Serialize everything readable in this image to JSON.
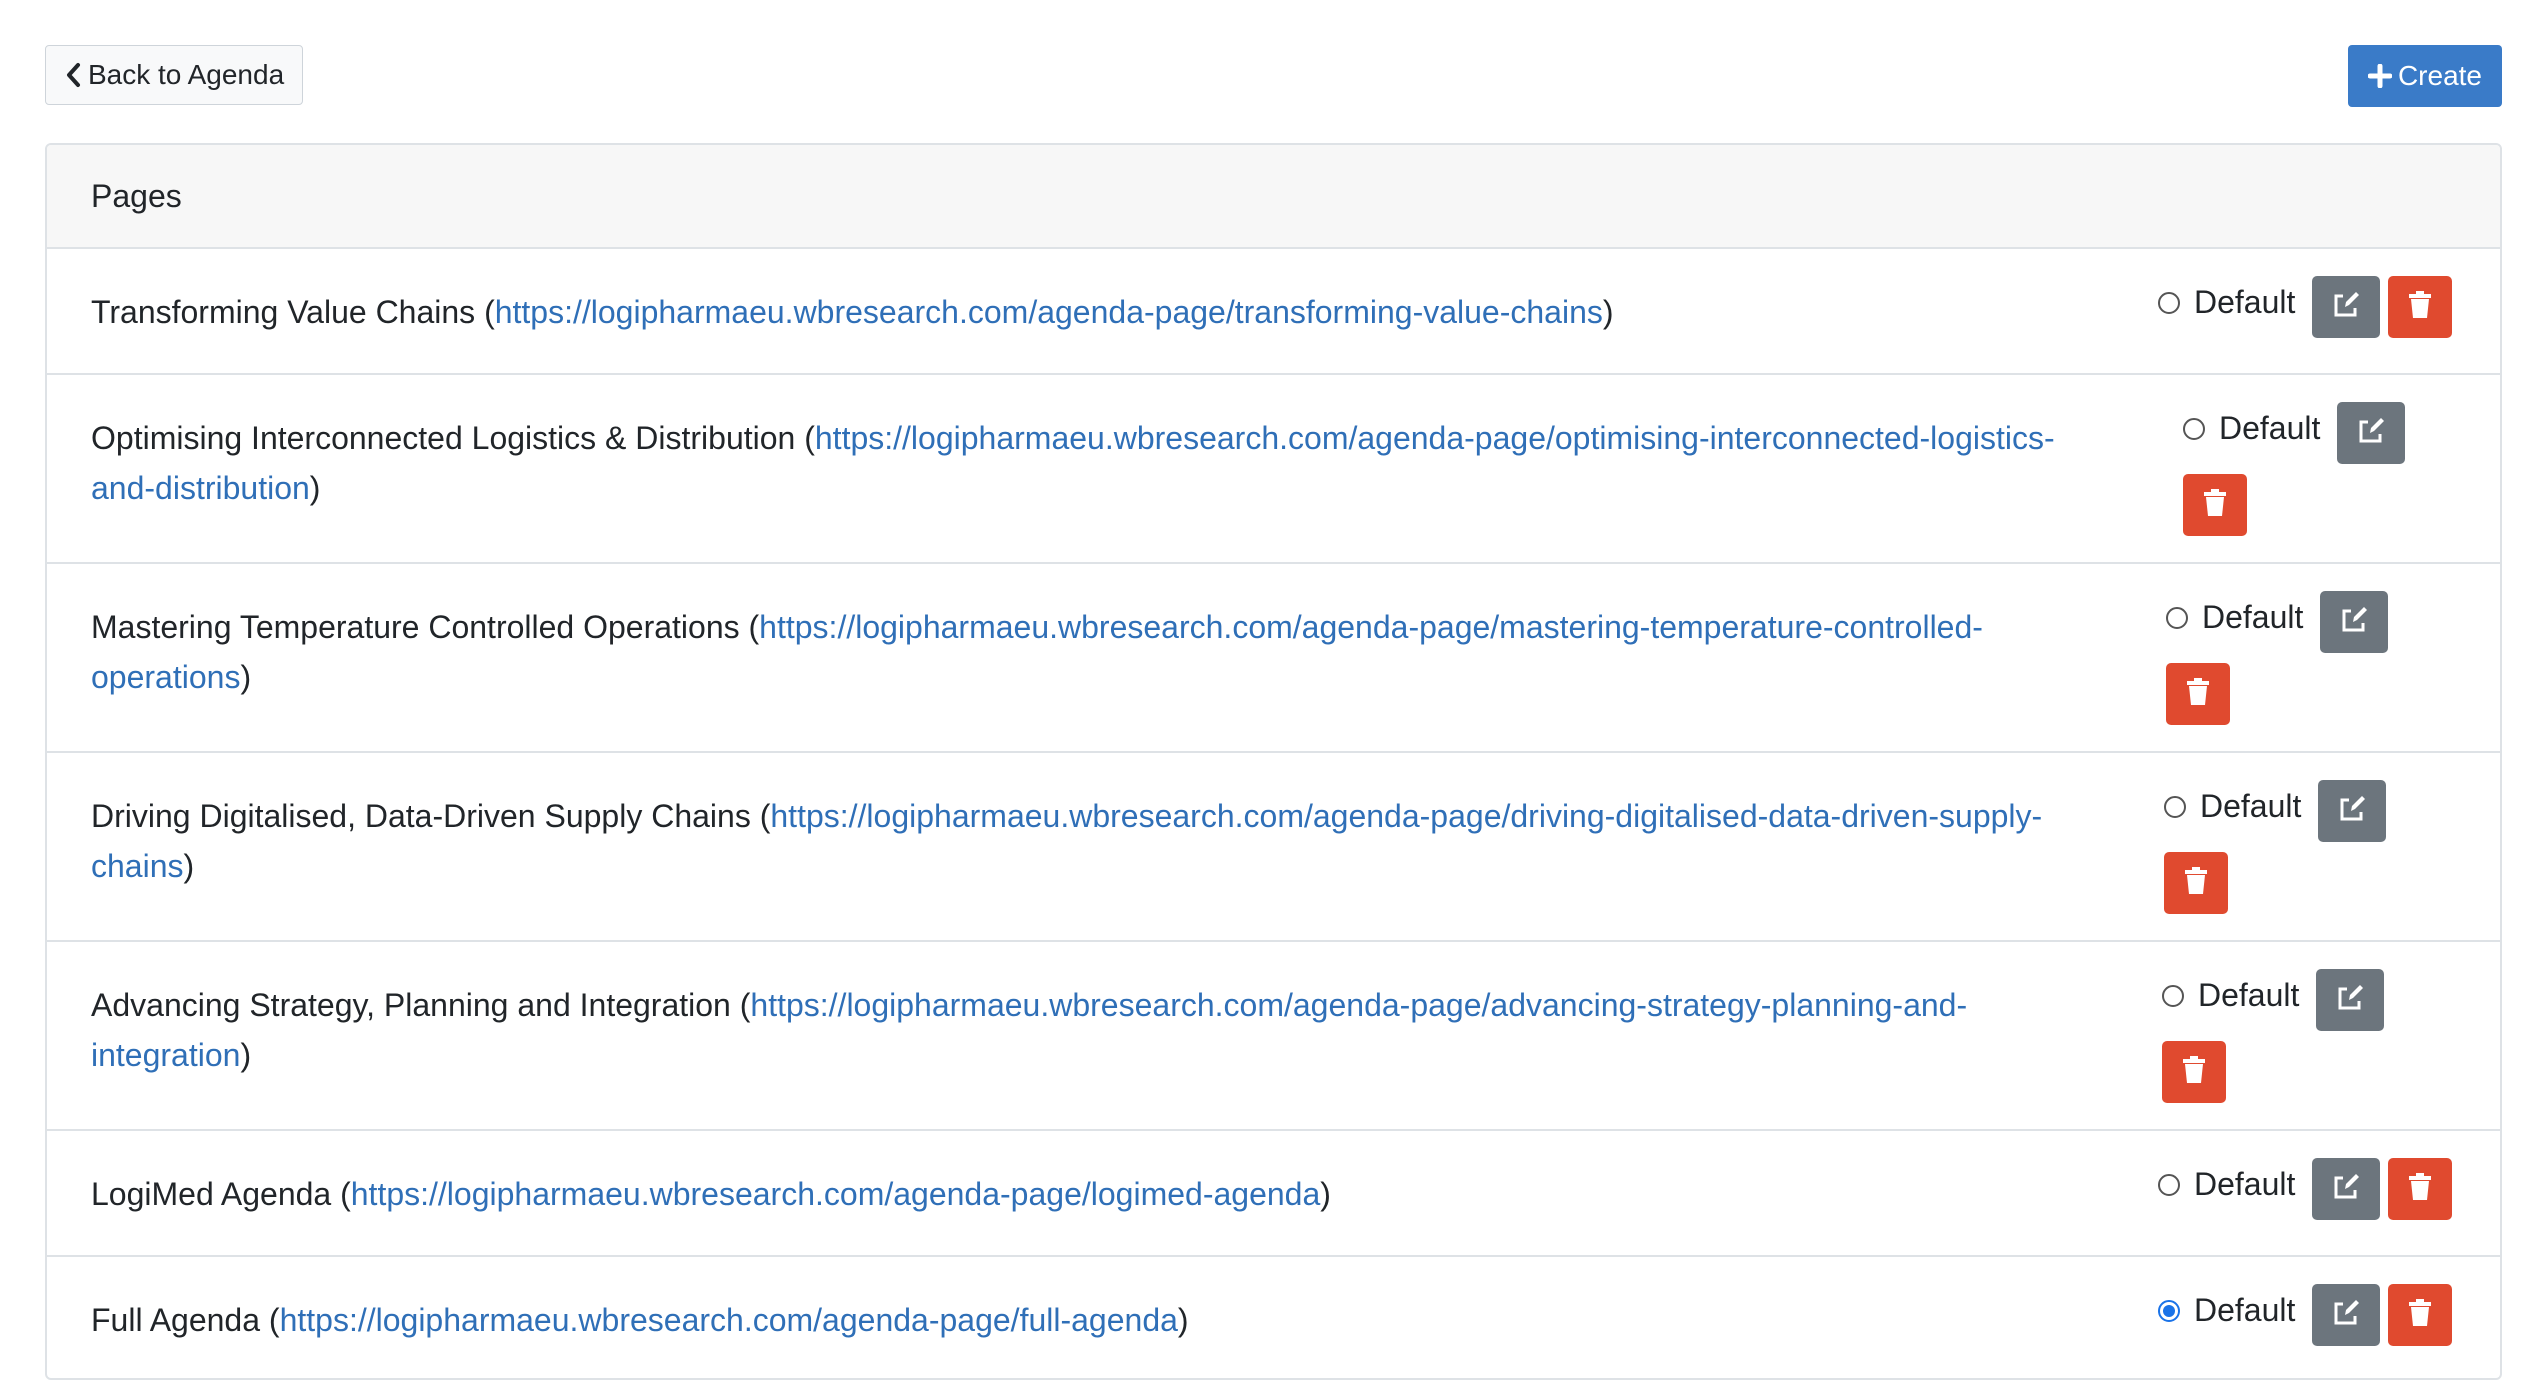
{
  "toolbar": {
    "back_label": "Back to Agenda",
    "create_label": "Create"
  },
  "card": {
    "header": "Pages"
  },
  "rows": [
    {
      "title": "Transforming Value Chains",
      "url": "https://logipharmaeu.wbresearch.com/agenda-page/transforming-value-chains",
      "url_line2": "",
      "default_label": "Default",
      "is_default": false
    },
    {
      "title": "Optimising Interconnected Logistics & Distribution",
      "url": "https://logipharmaeu.wbresearch.com/agenda-page/optimising-interconnected-logistics-",
      "url_line2": "and-distribution",
      "default_label": "Default",
      "is_default": false
    },
    {
      "title": "Mastering Temperature Controlled Operations",
      "url": "https://logipharmaeu.wbresearch.com/agenda-page/mastering-temperature-controlled-",
      "url_line2": "operations",
      "default_label": "Default",
      "is_default": false
    },
    {
      "title": "Driving Digitalised, Data-Driven Supply Chains",
      "url": "https://logipharmaeu.wbresearch.com/agenda-page/driving-digitalised-data-driven-supply-",
      "url_line2": "chains",
      "default_label": "Default",
      "is_default": false
    },
    {
      "title": "Advancing Strategy, Planning and Integration",
      "url": "https://logipharmaeu.wbresearch.com/agenda-page/advancing-strategy-planning-and-",
      "url_line2": "integration",
      "default_label": "Default",
      "is_default": false
    },
    {
      "title": "LogiMed Agenda",
      "url": "https://logipharmaeu.wbresearch.com/agenda-page/logimed-agenda",
      "url_line2": "",
      "default_label": "Default",
      "is_default": false
    },
    {
      "title": "Full Agenda",
      "url": "https://logipharmaeu.wbresearch.com/agenda-page/full-agenda",
      "url_line2": "",
      "default_label": "Default",
      "is_default": true
    }
  ],
  "icons": {
    "back": "chevron-left-icon",
    "create": "plus-icon",
    "edit": "edit-icon",
    "delete": "trash-icon"
  },
  "colors": {
    "primary": "#3a7bc8",
    "secondary": "#6c757d",
    "danger": "#e04a2f",
    "link": "#2f6fb7",
    "radio_checked": "#1a73e8"
  }
}
